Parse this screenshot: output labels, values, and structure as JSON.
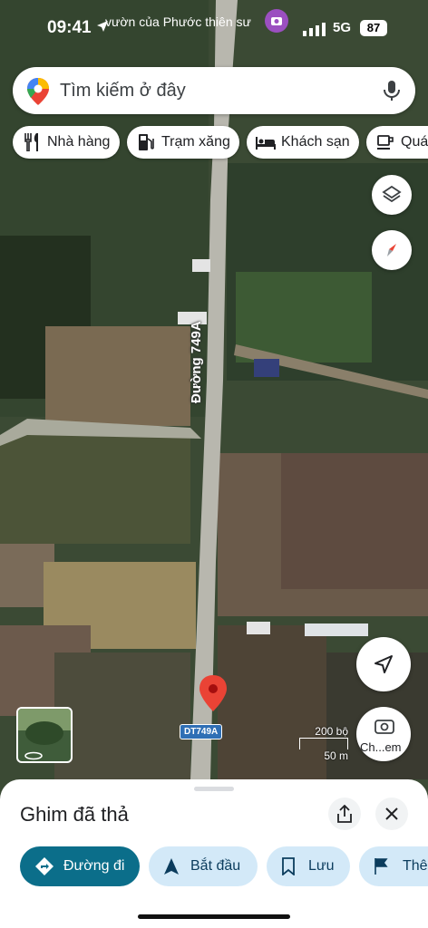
{
  "status": {
    "time": "09:41",
    "place": "vườn của Phước thiên sư",
    "network": "5G",
    "battery": "87"
  },
  "search": {
    "placeholder": "Tìm kiếm ở đây"
  },
  "chips": [
    "Nhà hàng",
    "Trạm xăng",
    "Khách sạn",
    "Quán"
  ],
  "map": {
    "road_name": "Đường 749A",
    "route_shield": "DT749A",
    "scale_feet": "200 bộ",
    "scale_m": "50 m",
    "streetview_label": "Ch...em"
  },
  "sheet": {
    "title": "Ghim đã thả",
    "actions": [
      "Đường đi",
      "Bắt đầu",
      "Lưu",
      "Thê"
    ]
  },
  "colors": {
    "accent": "#0b6e8a",
    "pin": "#ea4335",
    "action_bg": "#d3e9f8"
  }
}
